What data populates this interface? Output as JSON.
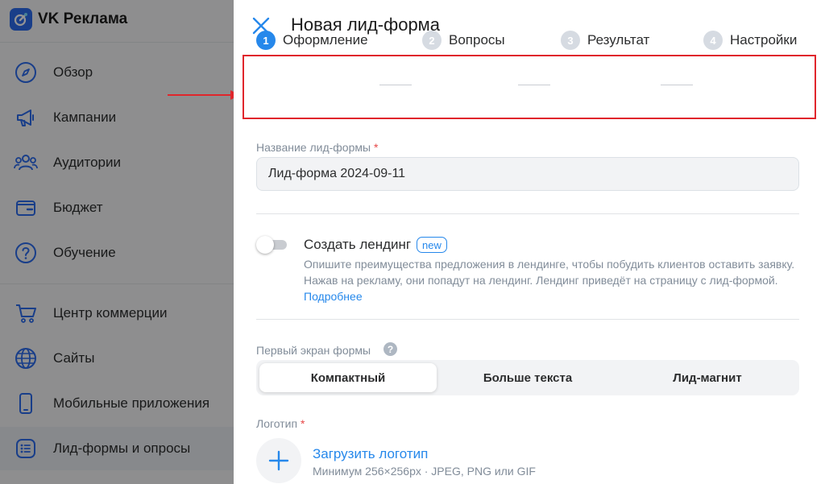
{
  "sidebar": {
    "brand": "VK Реклама",
    "items": [
      {
        "label": "Обзор",
        "icon": "compass-icon"
      },
      {
        "label": "Кампании",
        "icon": "megaphone-icon"
      },
      {
        "label": "Аудитории",
        "icon": "users-icon"
      },
      {
        "label": "Бюджет",
        "icon": "wallet-icon"
      },
      {
        "label": "Обучение",
        "icon": "question-icon"
      },
      {
        "label": "Центр коммерции",
        "icon": "cart-icon"
      },
      {
        "label": "Сайты",
        "icon": "globe-icon"
      },
      {
        "label": "Мобильные приложения",
        "icon": "smartphone-icon"
      },
      {
        "label": "Лид-формы и опросы",
        "icon": "list-icon"
      }
    ]
  },
  "panel": {
    "title": "Новая лид-форма",
    "steps": [
      {
        "num": "1",
        "label": "Оформление"
      },
      {
        "num": "2",
        "label": "Вопросы"
      },
      {
        "num": "3",
        "label": "Результат"
      },
      {
        "num": "4",
        "label": "Настройки"
      }
    ],
    "name_field": {
      "label": "Название лид-формы",
      "required_mark": "*",
      "value": "Лид-форма 2024-09-11"
    },
    "landing": {
      "title": "Создать лендинг",
      "badge": "new",
      "description": "Опишите преимущества предложения в лендинге, чтобы побудить клиентов оставить заявку. Нажав на рекламу, они попадут на лендинг. Лендинг приведёт на страницу с лид-формой.",
      "link": "Подробнее",
      "enabled": false
    },
    "first_screen": {
      "label": "Первый экран формы",
      "help": "?",
      "options": [
        "Компактный",
        "Больше текста",
        "Лид-магнит"
      ],
      "selected": "Компактный"
    },
    "logo": {
      "label": "Логотип",
      "required_mark": "*",
      "upload_label": "Загрузить логотип",
      "hint": "Минимум 256×256px · JPEG, PNG или GIF"
    }
  },
  "colors": {
    "accent": "#2688eb",
    "annotation": "#e0262c",
    "required": "#e64646"
  }
}
